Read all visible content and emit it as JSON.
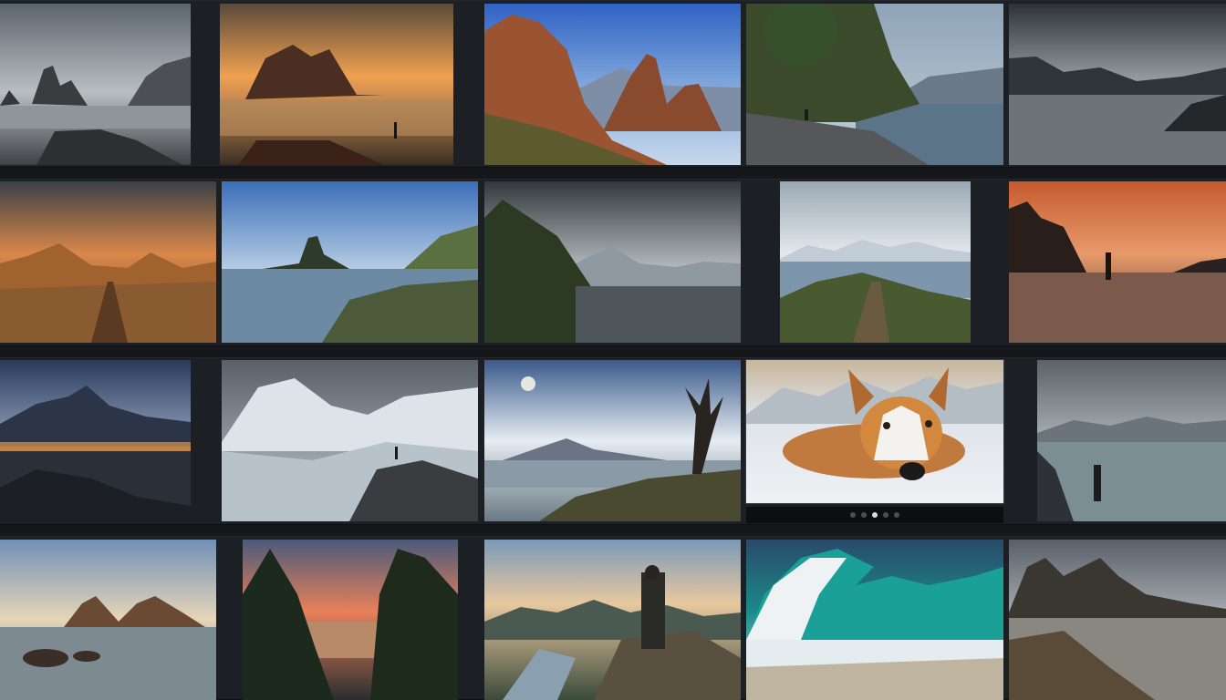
{
  "gallery": {
    "tiles": [
      {
        "id": 1,
        "name": "misty-sea-stacks"
      },
      {
        "id": 2,
        "name": "sunset-shore-figure"
      },
      {
        "id": 3,
        "name": "red-rock-spires"
      },
      {
        "id": 4,
        "name": "cliff-tree-lake"
      },
      {
        "id": 5,
        "name": "stormy-lake-mountains"
      },
      {
        "id": 6,
        "name": "golden-valley-path"
      },
      {
        "id": 7,
        "name": "island-peak-bay"
      },
      {
        "id": 8,
        "name": "forest-stormy-peaks"
      },
      {
        "id": 9,
        "name": "snowy-lake-trail"
      },
      {
        "id": 10,
        "name": "sunset-figure-water"
      },
      {
        "id": 11,
        "name": "night-city-mountain"
      },
      {
        "id": 12,
        "name": "snowy-glacier-hiker"
      },
      {
        "id": 13,
        "name": "moon-tree-hill"
      },
      {
        "id": 14,
        "name": "dog-in-snow"
      },
      {
        "id": 15,
        "name": "misty-lake-figure"
      },
      {
        "id": 16,
        "name": "calm-bay-rocks"
      },
      {
        "id": 17,
        "name": "pine-sunset-lake"
      },
      {
        "id": 18,
        "name": "wanderer-river-valley"
      },
      {
        "id": 19,
        "name": "turquoise-wave"
      },
      {
        "id": 20,
        "name": "rocky-beach-peaks"
      }
    ],
    "pager": {
      "count": 5,
      "active": 2
    },
    "colors": {
      "background": "#15171a",
      "row": "#1c1f23",
      "accent": "#d8dadc"
    }
  }
}
